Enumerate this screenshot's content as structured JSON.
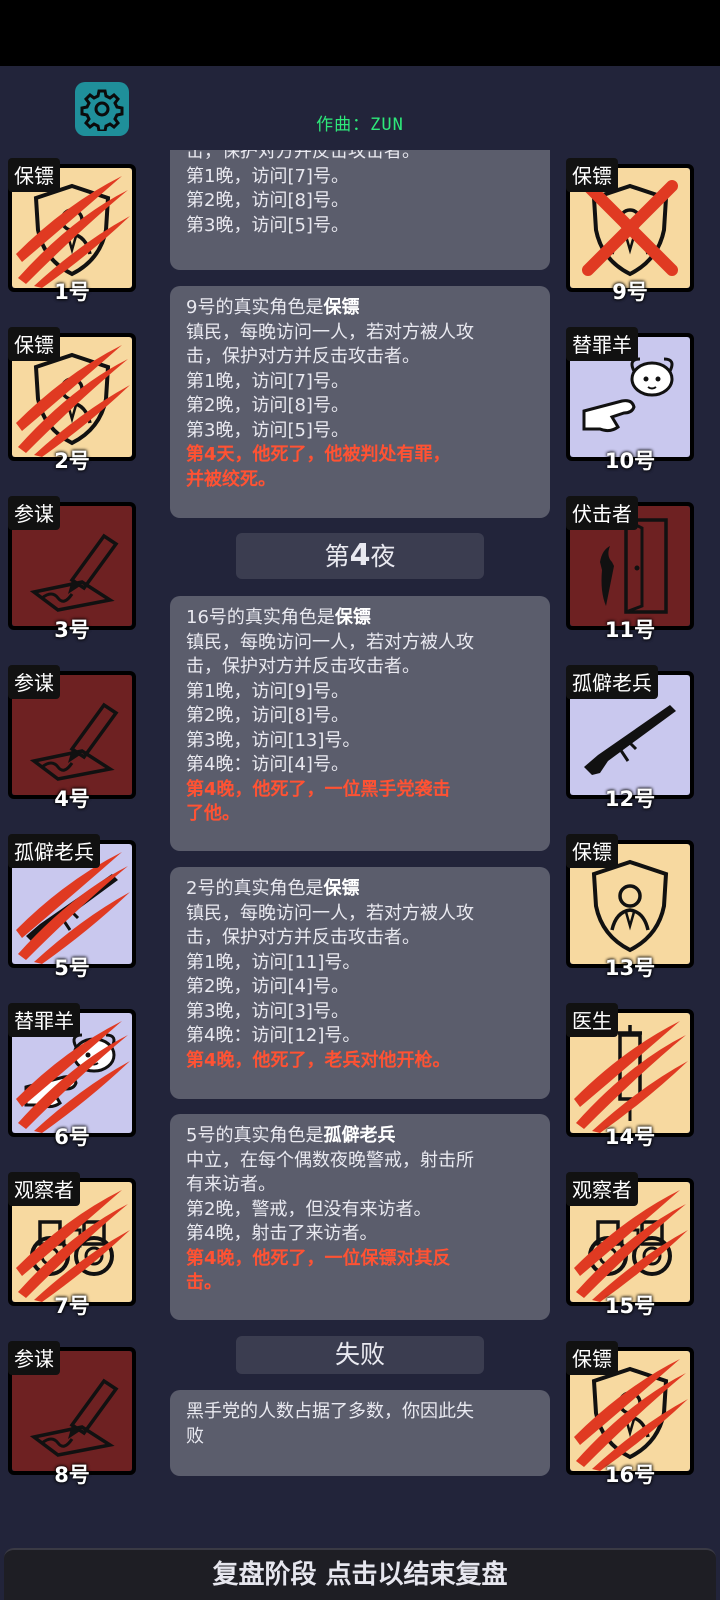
{
  "composer": "作曲：ZUN",
  "colors": {
    "bg": "#22243a",
    "card": "#5b5d6c",
    "death": "#ff5233",
    "town_tile": "#f7d9a0",
    "neutral_tile": "#c9c8ee",
    "mafia_tile": "#6e2122"
  },
  "left_players": [
    {
      "role": "保镖",
      "num": "1号",
      "icon": "shield-icon",
      "state": "slashed"
    },
    {
      "role": "保镖",
      "num": "2号",
      "icon": "shield-icon",
      "state": "slashed"
    },
    {
      "role": "参谋",
      "num": "3号",
      "icon": "pen-icon",
      "state": "alive"
    },
    {
      "role": "参谋",
      "num": "4号",
      "icon": "pen-icon",
      "state": "alive"
    },
    {
      "role": "孤僻老兵",
      "num": "5号",
      "icon": "rifle-icon",
      "state": "slashed"
    },
    {
      "role": "替罪羊",
      "num": "6号",
      "icon": "sheep-icon",
      "state": "slashed"
    },
    {
      "role": "观察者",
      "num": "7号",
      "icon": "binoculars-icon",
      "state": "slashed"
    },
    {
      "role": "参谋",
      "num": "8号",
      "icon": "pen-icon",
      "state": "alive"
    }
  ],
  "right_players": [
    {
      "role": "保镖",
      "num": "9号",
      "icon": "shield-icon",
      "state": "crossed"
    },
    {
      "role": "替罪羊",
      "num": "10号",
      "icon": "sheep-icon",
      "state": "alive"
    },
    {
      "role": "伏击者",
      "num": "11号",
      "icon": "knife-door-icon",
      "state": "alive"
    },
    {
      "role": "孤僻老兵",
      "num": "12号",
      "icon": "rifle-icon",
      "state": "alive"
    },
    {
      "role": "保镖",
      "num": "13号",
      "icon": "shield-icon",
      "state": "alive"
    },
    {
      "role": "医生",
      "num": "14号",
      "icon": "syringe-icon",
      "state": "slashed"
    },
    {
      "role": "观察者",
      "num": "15号",
      "icon": "binoculars-icon",
      "state": "slashed"
    },
    {
      "role": "保镖",
      "num": "16号",
      "icon": "shield-icon",
      "state": "slashed"
    }
  ],
  "log": {
    "card0": {
      "lines": [
        "击，保护对方并反击攻击者。",
        "第1晚，访问[7]号。",
        "第2晚，访问[8]号。",
        "第3晚，访问[5]号。"
      ]
    },
    "card1": {
      "title_prefix": "9号的真实角色是",
      "title_role": "保镖",
      "lines": [
        "镇民，每晚访问一人，若对方被人攻",
        "击，保护对方并反击攻击者。",
        "第1晚，访问[7]号。",
        "第2晚，访问[8]号。",
        "第3晚，访问[5]号。"
      ],
      "death": [
        "第4天，他死了，他被判处有罪，",
        "并被绞死。"
      ]
    },
    "night_prefix": "第",
    "night_num": "4",
    "night_suffix": "夜",
    "card2": {
      "title_prefix": "16号的真实角色是",
      "title_role": "保镖",
      "lines": [
        "镇民，每晚访问一人，若对方被人攻",
        "击，保护对方并反击攻击者。",
        "第1晚，访问[9]号。",
        "第2晚，访问[8]号。",
        "第3晚，访问[13]号。",
        "第4晚：访问[4]号。"
      ],
      "death": [
        "第4晚，他死了，一位黑手党袭击",
        "了他。"
      ]
    },
    "card3": {
      "title_prefix": "2号的真实角色是",
      "title_role": "保镖",
      "lines": [
        "镇民，每晚访问一人，若对方被人攻",
        "击，保护对方并反击攻击者。",
        "第1晚，访问[11]号。",
        "第2晚，访问[4]号。",
        "第3晚，访问[3]号。",
        "第4晚：访问[12]号。"
      ],
      "death": [
        "第4晚，他死了，老兵对他开枪。"
      ]
    },
    "card4": {
      "title_prefix": "5号的真实角色是",
      "title_role": "孤僻老兵",
      "lines": [
        "中立，在每个偶数夜晚警戒，射击所",
        "有来访者。",
        "第2晚，警戒，但没有来访者。",
        "第4晚，射击了来访者。"
      ],
      "death": [
        "第4晚，他死了，一位保镖对其反",
        "击。"
      ]
    },
    "result_label": "失败",
    "card5": {
      "lines": [
        "黑手党的人数占据了多数，你因此失",
        "败"
      ]
    }
  },
  "bottom_bar": "复盘阶段 点击以结束复盘"
}
